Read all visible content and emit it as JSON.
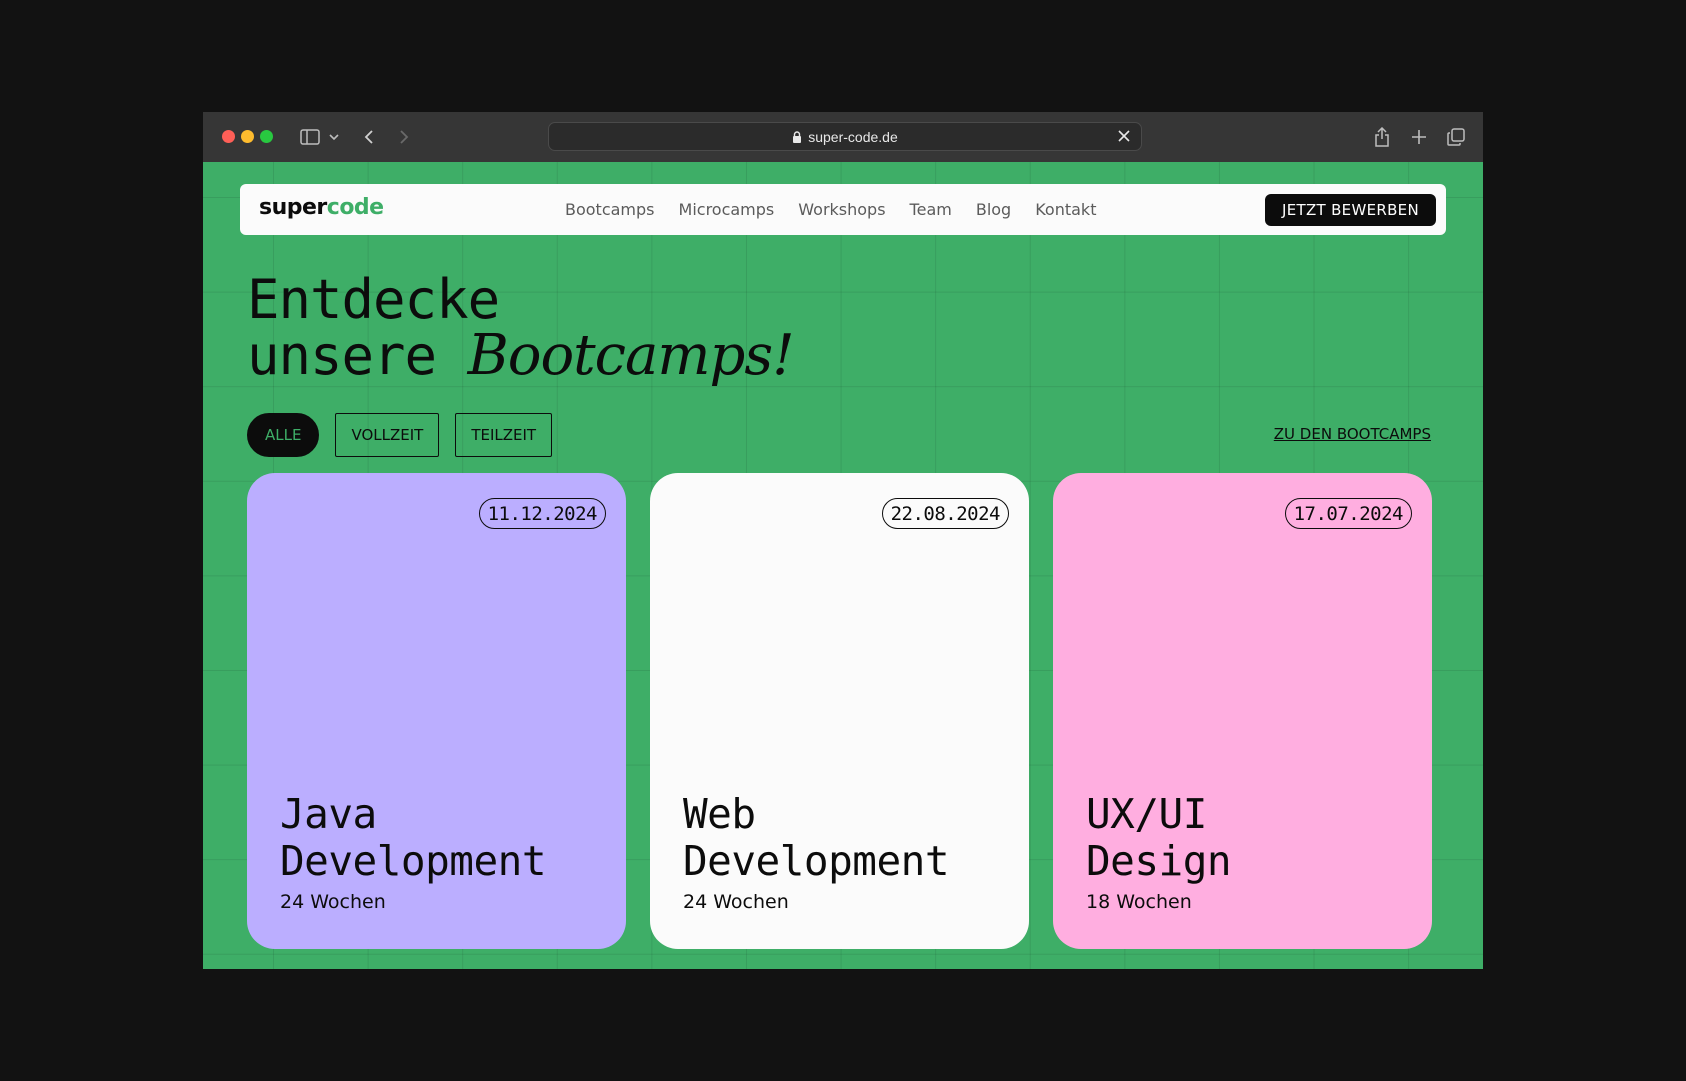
{
  "browser": {
    "url": "super-code.de"
  },
  "header": {
    "logo_part1": "super",
    "logo_part2": "code",
    "nav": [
      "Bootcamps",
      "Microcamps",
      "Workshops",
      "Team",
      "Blog",
      "Kontakt"
    ],
    "cta_label": "JETZT BEWERBEN"
  },
  "hero": {
    "line1": "Entdecke",
    "line2_plain": "unsere ",
    "line2_italic": "Bootcamps!"
  },
  "filters": {
    "items": [
      "ALLE",
      "VOLLZEIT",
      "TEILZEIT"
    ],
    "active": "ALLE",
    "all_link": "ZU DEN BOOTCAMPS"
  },
  "cards": [
    {
      "date": "11.12.2024",
      "title_line1": "Java",
      "title_line2": "Development",
      "duration": "24 Wochen",
      "color": "#bbaeff"
    },
    {
      "date": "22.08.2024",
      "title_line1": "Web",
      "title_line2": "Development",
      "duration": "24 Wochen",
      "color": "#fbfbfb"
    },
    {
      "date": "17.07.2024",
      "title_line1": "UX/UI",
      "title_line2": "Design",
      "duration": "18 Wochen",
      "color": "#ffaee0"
    }
  ],
  "colors": {
    "accent": "#3eae67",
    "dark": "#0c0c0c"
  },
  "icons": [
    "lock-icon",
    "sidebar-toggle-icon",
    "chevron-down-icon",
    "back-arrow-icon",
    "forward-arrow-icon",
    "close-icon",
    "share-icon",
    "new-tab-icon",
    "tabs-overview-icon"
  ]
}
